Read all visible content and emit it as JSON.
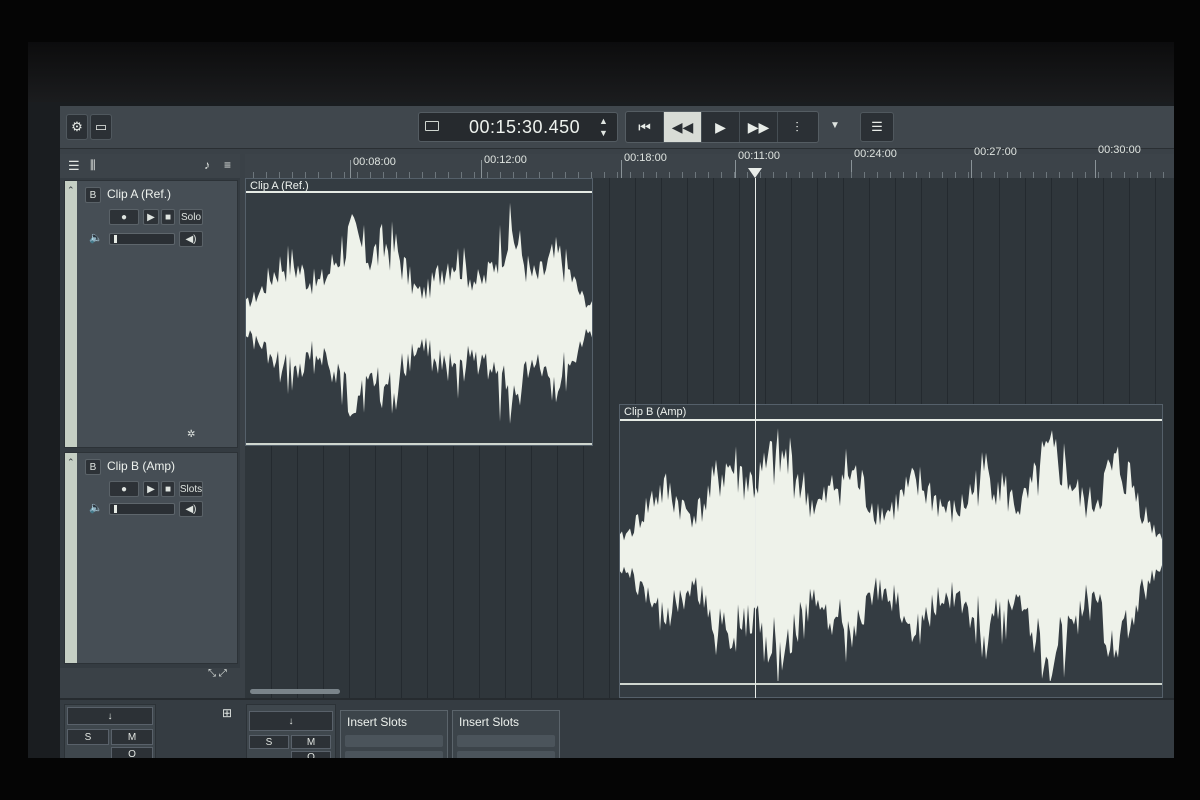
{
  "transport": {
    "timecode": "00:15:30.450"
  },
  "ruler": {
    "labels": [
      "00:08:00",
      "00:12:00",
      "00:18:00",
      "00:11:00",
      "00:24:00",
      "00:27:00",
      "00:30:00"
    ]
  },
  "tracks": [
    {
      "name": "Clip A (Ref.)",
      "badge": "B",
      "solo_label": "Solo",
      "record_icon": "record-icon",
      "monitor_icon": "monitor-icon",
      "volume_icon": "speaker-icon"
    },
    {
      "name": "Clip B (Amp)",
      "badge": "B",
      "solo_label": "Slots",
      "record_icon": "record-icon",
      "monitor_icon": "monitor-icon",
      "volume_icon": "speaker-icon"
    }
  ],
  "clips": [
    {
      "label": "Clip A (Ref.)"
    },
    {
      "label": "Clip B (Amp)"
    }
  ],
  "mixer": {
    "channel_buttons": [
      "S",
      "M",
      "O"
    ],
    "insert_slots_label_1": "Insert Slots",
    "insert_slots_label_2": "Insert Slots"
  },
  "colors": {
    "waveform": "#eef2ea",
    "track_strip": "#c5cfc4",
    "panel": "#3a4147"
  },
  "icons": {
    "settings": "gear-icon",
    "folder": "folder-icon",
    "screen": "screen-icon",
    "skip_start": "skip-start-icon",
    "rewind": "rewind-icon",
    "play": "play-icon",
    "fast_forward": "fast-forward-icon",
    "metronome": "metronome-icon",
    "mixer_toggle": "mixer-icon"
  }
}
